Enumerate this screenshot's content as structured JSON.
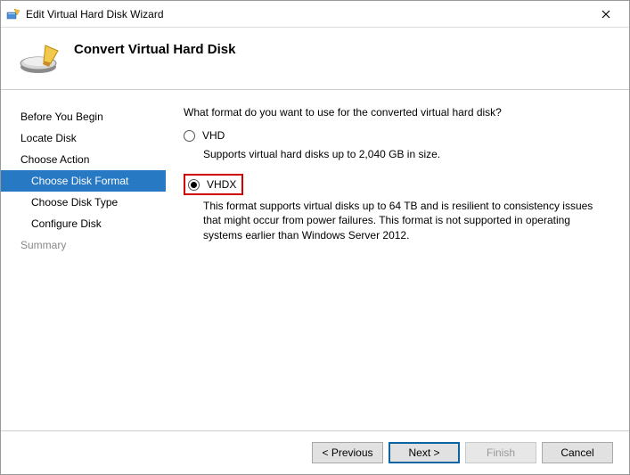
{
  "title": "Edit Virtual Hard Disk Wizard",
  "header": {
    "title": "Convert Virtual Hard Disk"
  },
  "sidebar": {
    "items": [
      {
        "label": "Before You Begin"
      },
      {
        "label": "Locate Disk"
      },
      {
        "label": "Choose Action"
      },
      {
        "label": "Choose Disk Format"
      },
      {
        "label": "Choose Disk Type"
      },
      {
        "label": "Configure Disk"
      },
      {
        "label": "Summary"
      }
    ]
  },
  "content": {
    "prompt": "What format do you want to use for the converted virtual hard disk?",
    "vhd_label": "VHD",
    "vhd_desc": "Supports virtual hard disks up to 2,040 GB in size.",
    "vhdx_label": "VHDX",
    "vhdx_desc": "This format supports virtual disks up to 64 TB and is resilient to consistency issues that might occur from power failures. This format is not supported in operating systems earlier than Windows Server 2012."
  },
  "footer": {
    "previous": "< Previous",
    "next": "Next >",
    "finish": "Finish",
    "cancel": "Cancel"
  }
}
